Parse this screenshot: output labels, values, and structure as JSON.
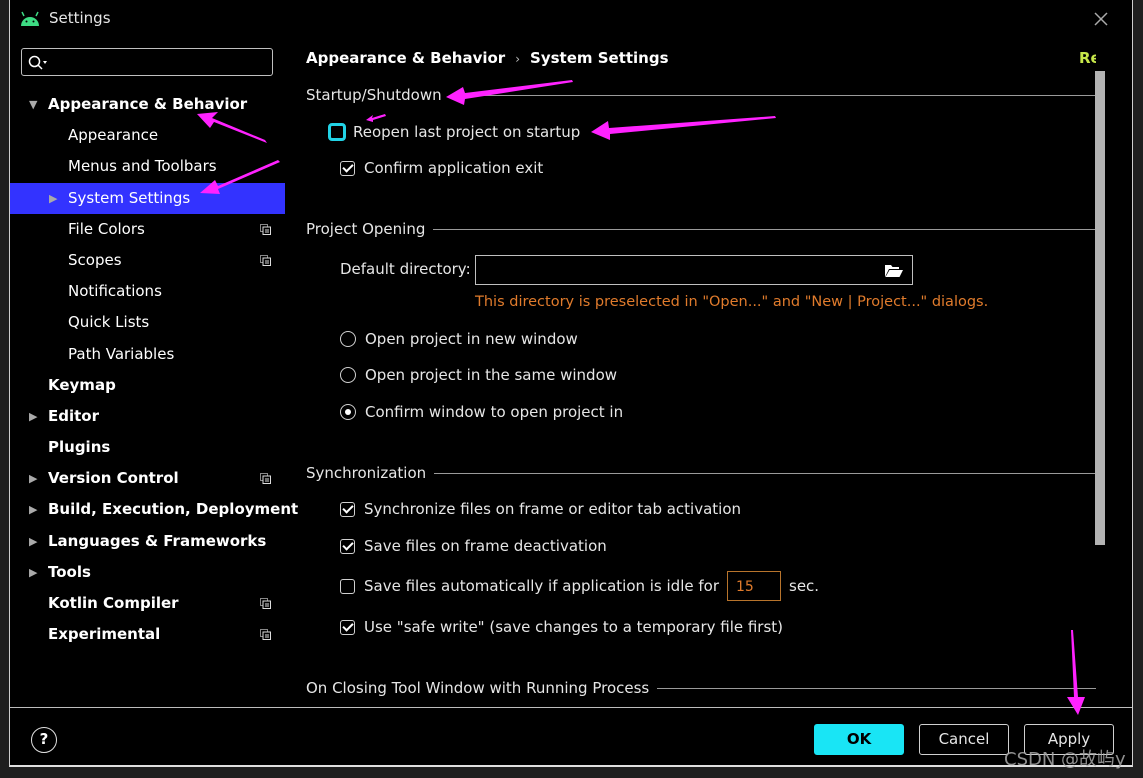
{
  "window": {
    "title": "Settings",
    "app_icon": "android-icon",
    "close_icon": "close-icon"
  },
  "search": {
    "placeholder": "",
    "value": ""
  },
  "sidebar": {
    "items": [
      {
        "label": "Appearance & Behavior",
        "level": 0,
        "bold": true,
        "expanded": true,
        "has_arrow": true,
        "copy_icon": false
      },
      {
        "label": "Appearance",
        "level": 1,
        "bold": false,
        "has_arrow": false,
        "copy_icon": false
      },
      {
        "label": "Menus and Toolbars",
        "level": 1,
        "bold": false,
        "has_arrow": false,
        "copy_icon": false
      },
      {
        "label": "System Settings",
        "level": 1,
        "bold": false,
        "has_arrow": true,
        "selected": true,
        "copy_icon": false
      },
      {
        "label": "File Colors",
        "level": 1,
        "bold": false,
        "has_arrow": false,
        "copy_icon": true
      },
      {
        "label": "Scopes",
        "level": 1,
        "bold": false,
        "has_arrow": false,
        "copy_icon": true
      },
      {
        "label": "Notifications",
        "level": 1,
        "bold": false,
        "has_arrow": false,
        "copy_icon": false
      },
      {
        "label": "Quick Lists",
        "level": 1,
        "bold": false,
        "has_arrow": false,
        "copy_icon": false
      },
      {
        "label": "Path Variables",
        "level": 1,
        "bold": false,
        "has_arrow": false,
        "copy_icon": false
      },
      {
        "label": "Keymap",
        "level": 0,
        "bold": true,
        "has_arrow": false,
        "copy_icon": false
      },
      {
        "label": "Editor",
        "level": 0,
        "bold": true,
        "has_arrow": true,
        "copy_icon": false
      },
      {
        "label": "Plugins",
        "level": 0,
        "bold": true,
        "has_arrow": false,
        "copy_icon": false
      },
      {
        "label": "Version Control",
        "level": 0,
        "bold": true,
        "has_arrow": true,
        "copy_icon": true
      },
      {
        "label": "Build, Execution, Deployment",
        "level": 0,
        "bold": true,
        "has_arrow": true,
        "copy_icon": false
      },
      {
        "label": "Languages & Frameworks",
        "level": 0,
        "bold": true,
        "has_arrow": true,
        "copy_icon": false
      },
      {
        "label": "Tools",
        "level": 0,
        "bold": true,
        "has_arrow": true,
        "copy_icon": false
      },
      {
        "label": "Kotlin Compiler",
        "level": 0,
        "bold": true,
        "has_arrow": false,
        "copy_icon": true
      },
      {
        "label": "Experimental",
        "level": 0,
        "bold": true,
        "has_arrow": false,
        "copy_icon": true
      }
    ]
  },
  "breadcrumb": {
    "parent": "Appearance & Behavior",
    "separator": "›",
    "current": "System Settings"
  },
  "reset_label": "Reset",
  "colors": {
    "accent_selected": "#3333ff",
    "reset": "#c7e84a",
    "ok_button": "#19e5f5",
    "hint": "#e07b2c",
    "focus_ring": "#22d3e6",
    "annotation_arrow": "#ff22ff"
  },
  "startup": {
    "title": "Startup/Shutdown",
    "reopen_last_project": {
      "label": "Reopen last project on startup",
      "checked": false
    },
    "confirm_exit": {
      "label": "Confirm application exit",
      "checked": true
    }
  },
  "project_opening": {
    "title": "Project Opening",
    "default_dir_label": "Default directory:",
    "default_dir_value": "",
    "hint": "This directory is preselected in \"Open...\" and \"New | Project...\" dialogs.",
    "radios": [
      {
        "label": "Open project in new window",
        "checked": false
      },
      {
        "label": "Open project in the same window",
        "checked": false
      },
      {
        "label": "Confirm window to open project in",
        "checked": true
      }
    ]
  },
  "synchronization": {
    "title": "Synchronization",
    "sync_on_activation": {
      "label": "Synchronize files on frame or editor tab activation",
      "checked": true
    },
    "save_on_deactivation": {
      "label": "Save files on frame deactivation",
      "checked": true
    },
    "save_idle": {
      "label": "Save files automatically if application is idle for",
      "checked": false,
      "value": "15",
      "unit": "sec."
    },
    "safe_write": {
      "label": "Use \"safe write\" (save changes to a temporary file first)",
      "checked": true
    }
  },
  "closing_tool_window": {
    "title": "On Closing Tool Window with Running Process"
  },
  "footer": {
    "help_label": "?",
    "ok_label": "OK",
    "cancel_label": "Cancel",
    "apply_label": "Apply"
  },
  "watermark": "CSDN @故屿y"
}
